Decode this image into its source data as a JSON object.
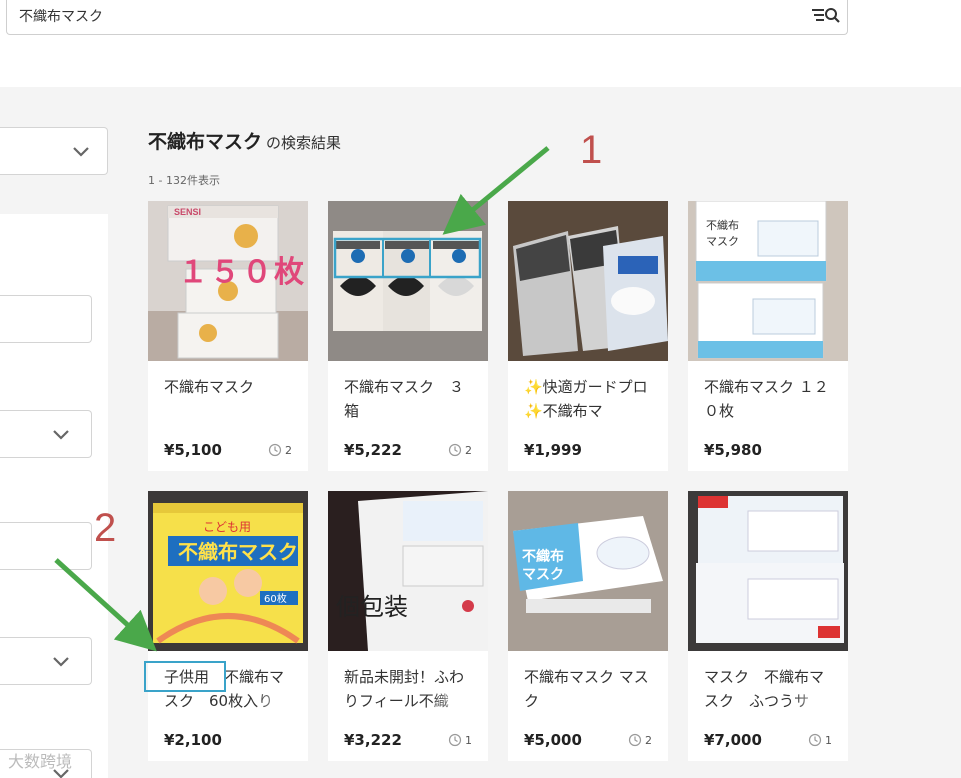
{
  "search": {
    "query": "不織布マスク"
  },
  "results": {
    "keyword": "不織布マスク",
    "suffix": "の検索結果",
    "count_label": "1 - 132件表示"
  },
  "items": [
    {
      "title": "不織布マスク",
      "price": "¥5,100",
      "likes": "2",
      "image_caption": "１５０枚"
    },
    {
      "title": "不織布マスク　３箱",
      "price": "¥5,222",
      "likes": "2"
    },
    {
      "title": "✨快適ガードプロ ✨不織布マ",
      "price": "¥1,999",
      "likes": ""
    },
    {
      "title": "不織布マスク １２０枚",
      "price": "¥5,980",
      "likes": ""
    },
    {
      "title": "子供用　不織布マスク　60枚入り",
      "price": "¥2,100",
      "likes": ""
    },
    {
      "title": "新品未開封！ふわりフィール不織",
      "price": "¥3,222",
      "likes": "1",
      "image_caption": "個包装"
    },
    {
      "title": "不織布マスク マスク",
      "price": "¥5,000",
      "likes": "2"
    },
    {
      "title": "マスク　不織布マスク　ふつうサ",
      "price": "¥7,000",
      "likes": "1"
    }
  ],
  "annotations": {
    "label_1": "1",
    "label_2": "2",
    "highlight_text": "子供用"
  },
  "watermark": "大数跨境",
  "colors": {
    "annotation_box": "#3aa3c9",
    "annotation_arrow": "#4aa84a",
    "annotation_number": "#c0504d"
  }
}
